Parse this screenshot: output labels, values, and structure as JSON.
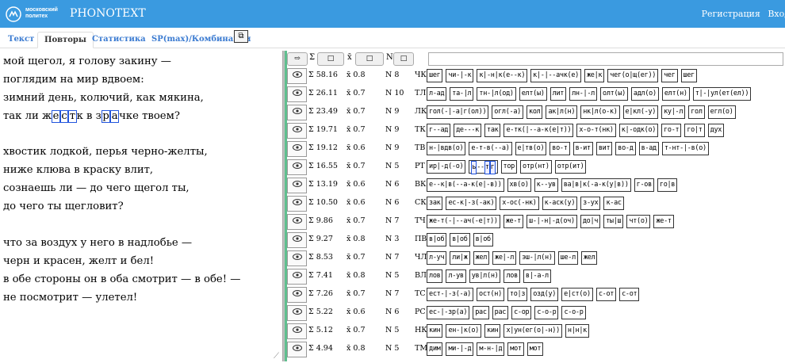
{
  "header": {
    "logo_line1": "московский",
    "logo_line2": "политех",
    "title": "PHONOTEXT",
    "link_register": "Регистрация",
    "link_login": "Вход"
  },
  "tabs": [
    "Текст",
    "Повторы",
    "Статистика",
    "SP(max)/Комбинации"
  ],
  "active_tab": "Повторы",
  "tab_icon": "⧉",
  "poem": [
    "мой щегол, я голову закину —",
    "поглядим на мир вдвоем:",
    "зимний день, колючий, как мякина,",
    "так ли жестк в зрачке твоем?",
    "",
    "хвостик лодкой, перья черно-желты,",
    "ниже клюва в краску влит,",
    "сознаешь ли — до чего щегол ты,",
    "до чего ты щегловит?",
    "",
    "что за воздух у него в надлобье —",
    "черн и красен, желт и бел!",
    "в обе стороны он в оба смотрит — в обе! —",
    "не посмотрит — улетел!"
  ],
  "filters": {
    "sort_btn": "⇨",
    "sum_label": "Σ",
    "sum_btn": "□",
    "avg_label": "x̄",
    "avg_btn": "□",
    "n_label": "N",
    "n_btn": "□"
  },
  "rows": [
    {
      "sum": "Σ 58.16",
      "avg": "x̄ 0.8",
      "n": "N 8",
      "tag": "ЧК",
      "chunks": [
        "шег",
        "чи-|-к",
        "к|-н|к(е--к)",
        "к|-|--ачк(е)",
        "же|к",
        "чег(о|щ(ег))",
        "чег",
        "шег"
      ]
    },
    {
      "sum": "Σ 26.11",
      "avg": "x̄ 0.7",
      "n": "N 10",
      "tag": "ТЛ",
      "chunks": [
        "л-ад",
        "та-|л",
        "тн-|л(од)",
        "елт(ы)",
        "лит",
        "лн-|-л",
        "олт(ы)",
        "адл(о)",
        "елт(н)",
        "т|-|ул(ет(ел))"
      ]
    },
    {
      "sum": "Σ 23.49",
      "avg": "x̄ 0.7",
      "n": "N 9",
      "tag": "ЛК",
      "chunks": [
        "гол(-|-а|г(ол))",
        "огл(-а)",
        "кол",
        "ак|л(н)",
        "нк|л(о-к)",
        "е|кл(-у)",
        "ку|-л",
        "гол",
        "егл(о)"
      ]
    },
    {
      "sum": "Σ 19.71",
      "avg": "x̄ 0.7",
      "n": "N 9",
      "tag": "ТК",
      "chunks": [
        "г--ад",
        "де---к",
        "так",
        "е-тк(|--а-к(е|т))",
        "х-о-т(нк)",
        "к|-одк(о)",
        "го-т",
        "го|т",
        "дух"
      ]
    },
    {
      "sum": "Σ 19.12",
      "avg": "x̄ 0.6",
      "n": "N 9",
      "tag": "ТВ",
      "chunks": [
        "н-|вдв(о)",
        "е-т-в(--а)",
        "е|тв(о)",
        "во-т",
        "в-ит",
        "вит",
        "во-д",
        "в-ад",
        "т-нт-|-в(о)"
      ]
    },
    {
      "sum": "Σ 16.55",
      "avg": "x̄ 0.7",
      "n": "N 5",
      "tag": "РТ",
      "chunks": [
        "ир|-д(-о)",
        "@@HL@@",
        "тор",
        "отр(нт)",
        "отр(ит)"
      ]
    },
    {
      "sum": "Σ 13.19",
      "avg": "x̄ 0.6",
      "n": "N 6",
      "tag": "ВК",
      "chunks": [
        "е--к|в(--а-к(е|-в))",
        "хв(о)",
        "к--ув",
        "ва|в|к(-а-к(у|в))",
        "г-ов",
        "го|в"
      ]
    },
    {
      "sum": "Σ 10.50",
      "avg": "x̄ 0.6",
      "n": "N 6",
      "tag": "СК",
      "chunks": [
        "зак",
        "ес-к|-з(-ак)",
        "х-ос(-нк)",
        "к-аск(у)",
        "з-ух",
        "к-ас"
      ]
    },
    {
      "sum": "Σ 9.86",
      "avg": "x̄ 0.7",
      "n": "N 7",
      "tag": "ТЧ",
      "chunks": [
        "же-т(-|--ач(-е|т))",
        "же-т",
        "ш-|-н|-д(оч)",
        "до|ч",
        "ты|ш",
        "чт(о)",
        "же-т"
      ]
    },
    {
      "sum": "Σ 9.27",
      "avg": "x̄ 0.8",
      "n": "N 3",
      "tag": "ПВ",
      "chunks": [
        "в|об",
        "в|об",
        "в|об"
      ]
    },
    {
      "sum": "Σ 8.53",
      "avg": "x̄ 0.7",
      "n": "N 7",
      "tag": "ЧЛ",
      "chunks": [
        "л-уч",
        "ли|ж",
        "жел",
        "же|-л",
        "эш-|л(н)",
        "ше-л",
        "жел"
      ]
    },
    {
      "sum": "Σ 7.41",
      "avg": "x̄ 0.8",
      "n": "N 5",
      "tag": "ВЛ",
      "chunks": [
        "лов",
        "л-ув",
        "ув|л(н)",
        "лов",
        "в|-а-л"
      ]
    },
    {
      "sum": "Σ 7.26",
      "avg": "x̄ 0.7",
      "n": "N 7",
      "tag": "ТС",
      "chunks": [
        "ест-|-з(-а)",
        "ост(н)",
        "то|з",
        "озд(у)",
        "е|ст(о)",
        "с-от",
        "с-от"
      ]
    },
    {
      "sum": "Σ 5.22",
      "avg": "x̄ 0.6",
      "n": "N 6",
      "tag": "РС",
      "chunks": [
        "ес-|-зр(а)",
        "рас",
        "рас",
        "с-ор",
        "с-о-р",
        "с-о-р"
      ]
    },
    {
      "sum": "Σ 5.12",
      "avg": "x̄ 0.7",
      "n": "N 5",
      "tag": "НК",
      "chunks": [
        "кин",
        "ен-|к(о)",
        "кин",
        "х|ун(ег(о|-н))",
        "н|н|к"
      ]
    },
    {
      "sum": "Σ 4.94",
      "avg": "x̄ 0.8",
      "n": "N 5",
      "tag": "ТМ",
      "chunks": [
        "дим",
        "ми-|-д",
        "м-н-|д",
        "мот",
        "мот"
      ]
    }
  ],
  "eye_icon_glyph": "👁",
  "hl_chunk_parts": [
    "ь",
    "-",
    "-",
    "т",
    "г"
  ]
}
